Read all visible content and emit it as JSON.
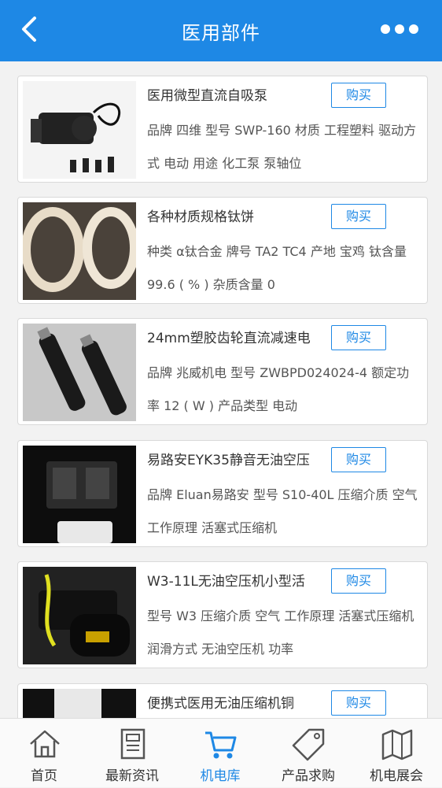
{
  "header": {
    "title": "医用部件"
  },
  "products": [
    {
      "name": "医用微型直流自吸泵",
      "buy": "购买",
      "desc": "品牌 四维 型号 SWP-160 材质 工程塑料 驱动方式 电动 用途 化工泵 泵轴位"
    },
    {
      "name": "各种材质规格钛饼",
      "buy": "购买",
      "desc": "种类 α钛合金 牌号 TA2 TC4 产地 宝鸡 钛含量 99.6 ( % ) 杂质含量 0"
    },
    {
      "name": "24mm塑胶齿轮直流减速电",
      "buy": "购买",
      "desc": "品牌 兆威机电 型号 ZWBPD024024-4 额定功率 12 ( W ) 产品类型 电动"
    },
    {
      "name": "易路安EYK35静音无油空压",
      "buy": "购买",
      "desc": "品牌 Eluan易路安 型号 S10-40L 压缩介质 空气 工作原理 活塞式压缩机"
    },
    {
      "name": "W3-11L无油空压机小型活",
      "buy": "购买",
      "desc": "型号 W3 压缩介质 空气 工作原理 活塞式压缩机 润滑方式 无油空压机 功率"
    },
    {
      "name": "便携式医用无油压缩机铜",
      "buy": "购买",
      "desc": ""
    }
  ],
  "tabs": [
    {
      "label": "首页",
      "icon": "home-icon"
    },
    {
      "label": "最新资讯",
      "icon": "news-icon"
    },
    {
      "label": "机电库",
      "icon": "cart-icon"
    },
    {
      "label": "产品求购",
      "icon": "tag-icon"
    },
    {
      "label": "机电展会",
      "icon": "map-icon"
    }
  ],
  "colors": {
    "accent": "#1e88e5"
  }
}
